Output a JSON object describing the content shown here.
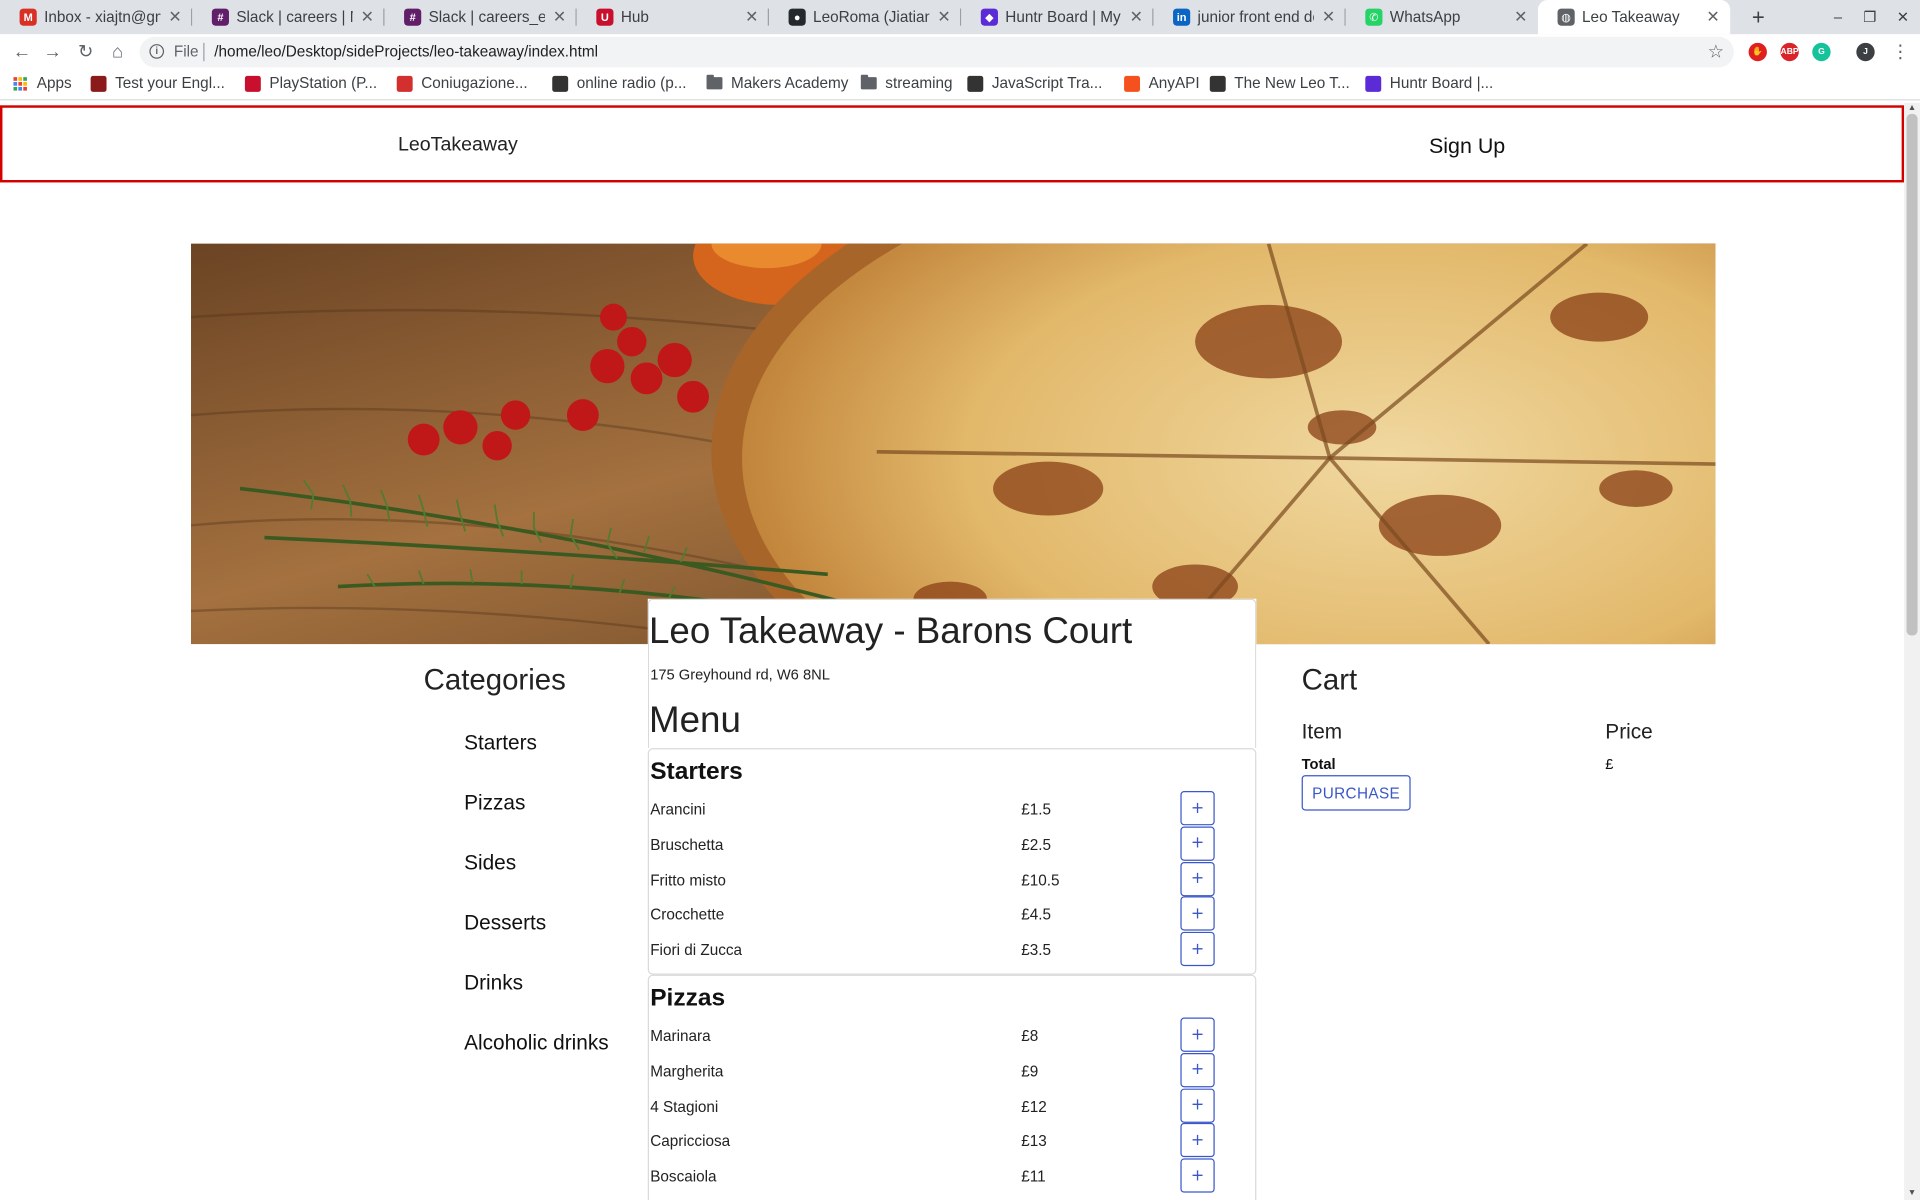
{
  "browser": {
    "tabs": [
      {
        "title": "Inbox - xiajtn@gm",
        "icon": "gmail-icon",
        "color": "#d93025",
        "glyph": "M"
      },
      {
        "title": "Slack | careers | Ma",
        "icon": "slack-icon",
        "color": "#611f69",
        "glyph": "#"
      },
      {
        "title": "Slack | careers_eve",
        "icon": "slack-icon",
        "color": "#611f69",
        "glyph": "#"
      },
      {
        "title": "Hub",
        "icon": "makers-hub-icon",
        "color": "#c8102e",
        "glyph": "U"
      },
      {
        "title": "LeoRoma (Jiatian",
        "icon": "github-icon",
        "color": "#24292e",
        "glyph": "●"
      },
      {
        "title": "Huntr Board | My F",
        "icon": "huntr-icon",
        "color": "#5b2bd6",
        "glyph": "◆"
      },
      {
        "title": "junior front end de",
        "icon": "linkedin-icon",
        "color": "#0a66c2",
        "glyph": "in"
      },
      {
        "title": "WhatsApp",
        "icon": "whatsapp-icon",
        "color": "#25d366",
        "glyph": "✆"
      },
      {
        "title": "Leo Takeaway",
        "icon": "globe-icon",
        "color": "#5f6368",
        "glyph": "◍",
        "active": true
      }
    ],
    "new_tab": "+",
    "window_controls": {
      "minimize": "–",
      "restore": "❐",
      "close": "✕"
    },
    "address": {
      "scheme_label": "File",
      "url": "/home/leo/Desktop/sideProjects/leo-takeaway/index.html"
    },
    "extensions": [
      {
        "name": "adblock-icon",
        "color": "#e0201e",
        "glyph": "✋"
      },
      {
        "name": "abp-icon",
        "color": "#d9252a",
        "glyph": "ABP"
      },
      {
        "name": "grammarly-icon",
        "color": "#15c39a",
        "glyph": "G"
      },
      {
        "name": "profile-avatar",
        "color": "#3c4043",
        "glyph": "J"
      }
    ],
    "bookmarks": [
      {
        "label": "Apps",
        "icon": "apps-grid-icon"
      },
      {
        "label": "Test your Engl...",
        "icon": "cambridge-icon",
        "color": "#8b1a1a"
      },
      {
        "label": "PlayStation (P...",
        "icon": "playstation-icon",
        "color": "#c8102e"
      },
      {
        "label": "Coniugazione...",
        "icon": "coniugazione-icon",
        "color": "#d32f2f"
      },
      {
        "label": "online radio (p...",
        "icon": "radio-icon",
        "color": "#333333"
      },
      {
        "label": "Makers Academy",
        "icon": "folder-icon"
      },
      {
        "label": "streaming",
        "icon": "folder-icon"
      },
      {
        "label": "JavaScript Tra...",
        "icon": "code-icon",
        "color": "#333333"
      },
      {
        "label": "AnyAPI",
        "icon": "anyapi-icon",
        "color": "#f4511e"
      },
      {
        "label": "The New Leo T...",
        "icon": "page-icon",
        "color": "#333333"
      },
      {
        "label": "Huntr Board |...",
        "icon": "huntr-icon",
        "color": "#5b2bd6"
      }
    ]
  },
  "site": {
    "brand": "LeoTakeaway",
    "signup": "Sign Up",
    "categories_title": "Categories",
    "categories": [
      "Starters",
      "Pizzas",
      "Sides",
      "Desserts",
      "Drinks",
      "Alcoholic drinks"
    ],
    "restaurant_name": "Leo Takeaway - Barons Court",
    "address": "175 Greyhound rd, W6 8NL",
    "menu_title": "Menu",
    "add_label": "+",
    "sections": [
      {
        "title": "Starters",
        "items": [
          {
            "name": "Arancini",
            "price": "£1.5"
          },
          {
            "name": "Bruschetta",
            "price": "£2.5"
          },
          {
            "name": "Fritto misto",
            "price": "£10.5"
          },
          {
            "name": "Crocchette",
            "price": "£4.5"
          },
          {
            "name": "Fiori di Zucca",
            "price": "£3.5"
          }
        ]
      },
      {
        "title": "Pizzas",
        "items": [
          {
            "name": "Marinara",
            "price": "£8"
          },
          {
            "name": "Margherita",
            "price": "£9"
          },
          {
            "name": "4 Stagioni",
            "price": "£12"
          },
          {
            "name": "Capricciosa",
            "price": "£13"
          },
          {
            "name": "Boscaiola",
            "price": "£11"
          }
        ]
      }
    ],
    "cart": {
      "title": "Cart",
      "col_item": "Item",
      "col_price": "Price",
      "total_label": "Total",
      "total_value": "£",
      "purchase": "PURCHASE"
    }
  },
  "colors": {
    "navbar_border": "#d40000",
    "button_accent": "#3a57c9"
  }
}
